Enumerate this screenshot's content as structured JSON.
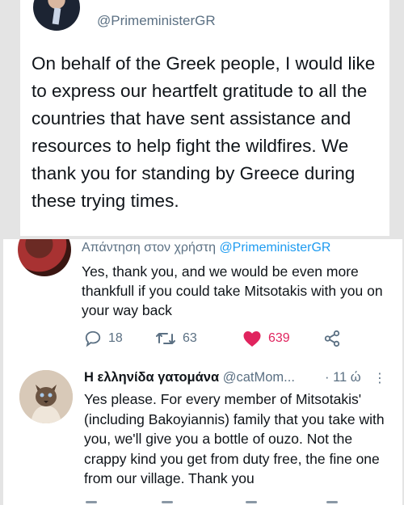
{
  "top_tweet": {
    "handle": "@PrimeministerGR",
    "text": "On behalf of the Greek people, I would like to express our heartfelt gratitude to all the countries that have sent assistance and resources to help fight the wildfires. We thank you for standing by Greece during these trying times."
  },
  "reply1": {
    "reply_to_prefix": "Απάντηση στον χρήστη",
    "reply_to_handle": "@PrimeministerGR",
    "text": "Yes, thank you, and we would be even more thankfull if you could take Mitsotakis with you on your way back",
    "actions": {
      "replies": "18",
      "retweets": "63",
      "likes": "639",
      "like_color": "#e0245e"
    }
  },
  "reply2": {
    "name": "Η ελληνίδα γατομάνα",
    "handle": "@catMom...",
    "time": "· 11 ώ",
    "more": "⋮",
    "text": "Yes please. For every member of Mitsotakis' (including Bakoyiannis) family that you take with you, we'll give you a bottle of ouzo. Not the crappy kind you get from duty free, the fine one from our village. Thank you"
  }
}
